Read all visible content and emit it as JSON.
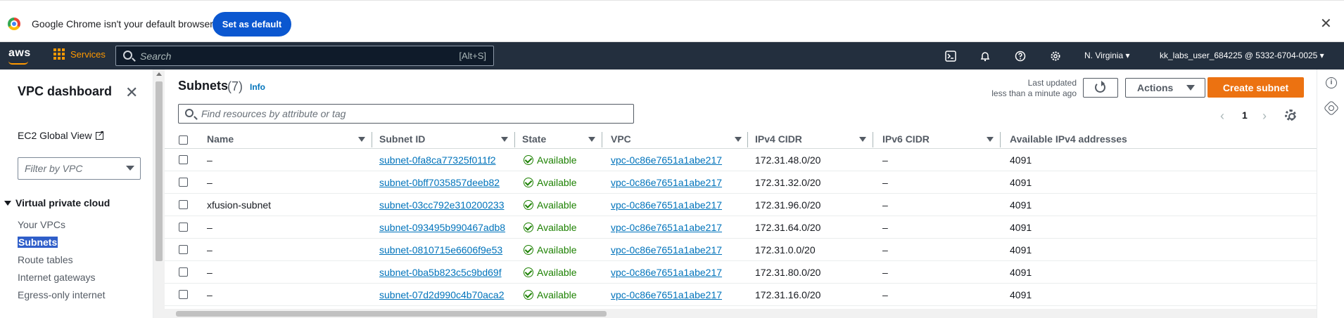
{
  "chrome": {
    "message": "Google Chrome isn't your default browser",
    "set_default": "Set as default",
    "close": "✕"
  },
  "nav": {
    "logo": "aws",
    "services": "Services",
    "search_placeholder": "Search",
    "search_shortcut": "[Alt+S]",
    "region": "N. Virginia ▾",
    "account": "kk_labs_user_684225 @ 5332-6704-0025 ▾"
  },
  "sidebar": {
    "title": "VPC dashboard",
    "ec2_global_view": "EC2 Global View",
    "filter_placeholder": "Filter by VPC",
    "section": "Virtual private cloud",
    "items": [
      "Your VPCs",
      "Subnets",
      "Route tables",
      "Internet gateways",
      "Egress-only internet"
    ]
  },
  "main": {
    "title": "Subnets",
    "count": "(7)",
    "info": "Info",
    "last_updated": "Last updated",
    "last_updated_value": "less than a minute ago",
    "actions": "Actions",
    "create": "Create subnet",
    "search_placeholder": "Find resources by attribute or tag",
    "page": "1",
    "prev": "‹",
    "next": "›"
  },
  "table": {
    "headers": [
      "Name",
      "Subnet ID",
      "State",
      "VPC",
      "IPv4 CIDR",
      "IPv6 CIDR",
      "Available IPv4 addresses"
    ],
    "rows": [
      {
        "name": "–",
        "subnet_id": "subnet-0fa8ca77325f011f2",
        "state": "Available",
        "vpc": "vpc-0c86e7651a1abe217",
        "ipv4": "172.31.48.0/20",
        "ipv6": "–",
        "avail": "4091"
      },
      {
        "name": "–",
        "subnet_id": "subnet-0bff7035857deeb82",
        "state": "Available",
        "vpc": "vpc-0c86e7651a1abe217",
        "ipv4": "172.31.32.0/20",
        "ipv6": "–",
        "avail": "4091"
      },
      {
        "name": "xfusion-subnet",
        "subnet_id": "subnet-03cc792e310200233",
        "state": "Available",
        "vpc": "vpc-0c86e7651a1abe217",
        "ipv4": "172.31.96.0/20",
        "ipv6": "–",
        "avail": "4091"
      },
      {
        "name": "–",
        "subnet_id": "subnet-093495b990467adb8",
        "state": "Available",
        "vpc": "vpc-0c86e7651a1abe217",
        "ipv4": "172.31.64.0/20",
        "ipv6": "–",
        "avail": "4091"
      },
      {
        "name": "–",
        "subnet_id": "subnet-0810715e6606f9e53",
        "state": "Available",
        "vpc": "vpc-0c86e7651a1abe217",
        "ipv4": "172.31.0.0/20",
        "ipv6": "–",
        "avail": "4091"
      },
      {
        "name": "–",
        "subnet_id": "subnet-0ba5b823c5c9bd69f",
        "state": "Available",
        "vpc": "vpc-0c86e7651a1abe217",
        "ipv4": "172.31.80.0/20",
        "ipv6": "–",
        "avail": "4091"
      },
      {
        "name": "–",
        "subnet_id": "subnet-07d2d990c4b70aca2",
        "state": "Available",
        "vpc": "vpc-0c86e7651a1abe217",
        "ipv4": "172.31.16.0/20",
        "ipv6": "–",
        "avail": "4091"
      }
    ]
  },
  "colors": {
    "nav_bg": "#232f3e",
    "accent": "#ff9900",
    "primary_button": "#ec7211",
    "link": "#0073bb",
    "available": "#1d8102",
    "sidebar_active": "#2f5ec9"
  }
}
